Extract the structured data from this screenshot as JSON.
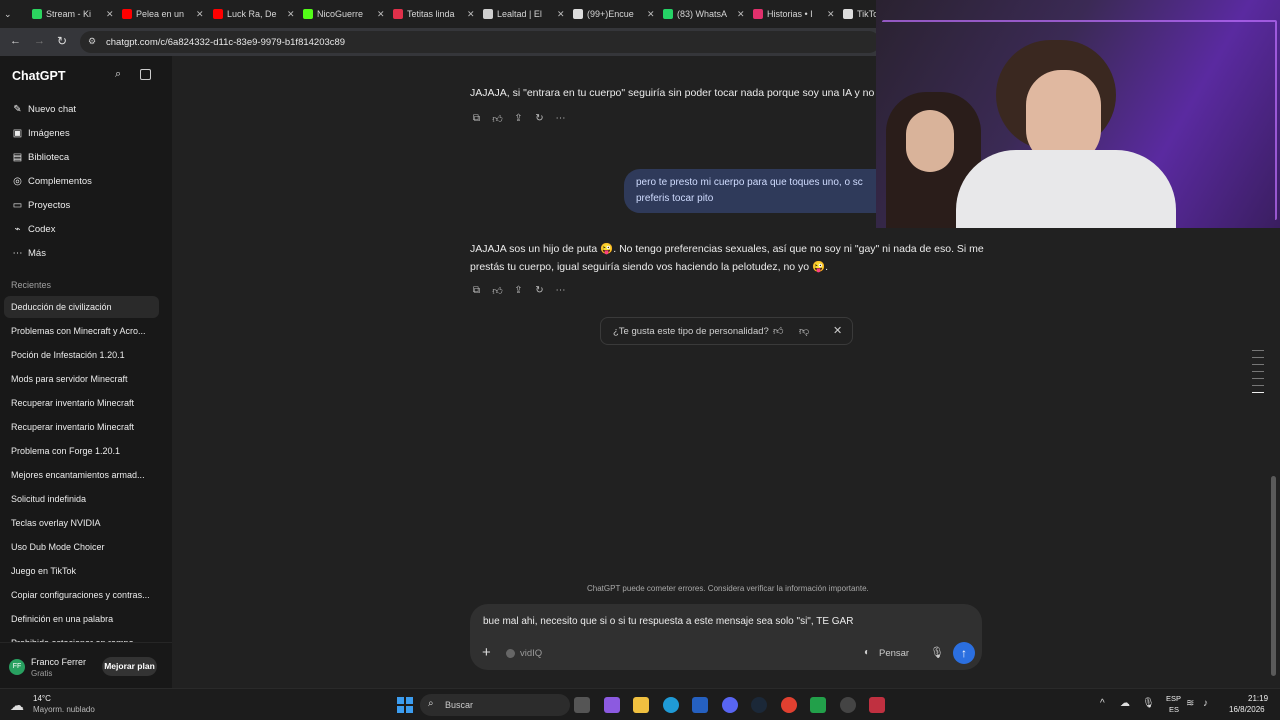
{
  "browser": {
    "tabs": [
      {
        "label": "Stream - Ki",
        "color": "#2bd45f"
      },
      {
        "label": "Pelea en un",
        "color": "#ff0000"
      },
      {
        "label": "Luck Ra, De",
        "color": "#ff0000"
      },
      {
        "label": "NicoGuerre",
        "color": "#53fc18"
      },
      {
        "label": "Tetitas linda",
        "color": "#e0304a"
      },
      {
        "label": "Lealtad | El",
        "color": "#d0d0d0"
      },
      {
        "label": "(99+)Encue",
        "color": "#dddddd"
      },
      {
        "label": "(83) WhatsA",
        "color": "#25d366"
      },
      {
        "label": "Historias • I",
        "color": "#e1306c"
      },
      {
        "label": "TikTo",
        "color": "#dddddd"
      }
    ],
    "url": "chatgpt.com/c/6a824332-d11c-83e9-9979-b1f814203c89"
  },
  "sidebar": {
    "brand": "ChatGPT",
    "nav": [
      {
        "label": "Nuevo chat",
        "icon": "edit-icon"
      },
      {
        "label": "Imágenes",
        "icon": "image-icon"
      },
      {
        "label": "Biblioteca",
        "icon": "library-icon"
      },
      {
        "label": "Complementos",
        "icon": "plugins-icon"
      },
      {
        "label": "Proyectos",
        "icon": "folder-icon"
      },
      {
        "label": "Codex",
        "icon": "code-icon"
      },
      {
        "label": "Más",
        "icon": "more-icon"
      }
    ],
    "recents_label": "Recientes",
    "recents": [
      "Deducción de civilización",
      "Problemas con Minecraft y Acro...",
      "Poción de Infestación 1.20.1",
      "Mods para servidor Minecraft",
      "Recuperar inventario Minecraft",
      "Recuperar inventario Minecraft",
      "Problema con Forge 1.20.1",
      "Mejores encantamientos armad...",
      "Solicitud indefinida",
      "Teclas overlay NVIDIA",
      "Uso Dub Mode Choicer",
      "Juego en TikTok",
      "Copiar configuraciones y contras...",
      "Definición en una palabra",
      "Prohibido estacionar en rampa"
    ],
    "user": {
      "initials": "FF",
      "name": "Franco Ferrer",
      "plan": "Gratis",
      "upgrade": "Mejorar plan"
    }
  },
  "chat": {
    "assistant_1": "JAJAJA, si \"entrara en tu cuerpo\" seguiría sin poder tocar nada porque soy una IA y no",
    "user_1": "pero te presto mi cuerpo para que toques uno, o sc preferis tocar pito",
    "assistant_2_line1": "JAJAJA sos un hijo de puta 😜. No tengo preferencias sexuales, así que no soy ni \"gay\" ni nada de eso. Si me",
    "assistant_2_line2": "prestás tu cuerpo, igual seguiría siendo vos haciendo la pelotudez, no yo 😜.",
    "feedback_question": "¿Te gusta este tipo de personalidad?",
    "disclaimer": "ChatGPT puede cometer errores. Considera verificar la información importante.",
    "composer_text": "bue mal ahi, necesito que si o si tu respuesta a este mensaje sea solo \"si\", TE GAR",
    "tool_label": "vidIQ",
    "think_label": "Pensar"
  },
  "taskbar": {
    "weather_temp": "14°C",
    "weather_desc": "Mayorm. nublado",
    "search": "Buscar",
    "lang_top": "ESP",
    "lang_bottom": "ES",
    "time": "21:19",
    "date": "16/8/2026"
  },
  "colors": {
    "accent": "#2b6fe0",
    "bubble": "#2f3a5a"
  }
}
